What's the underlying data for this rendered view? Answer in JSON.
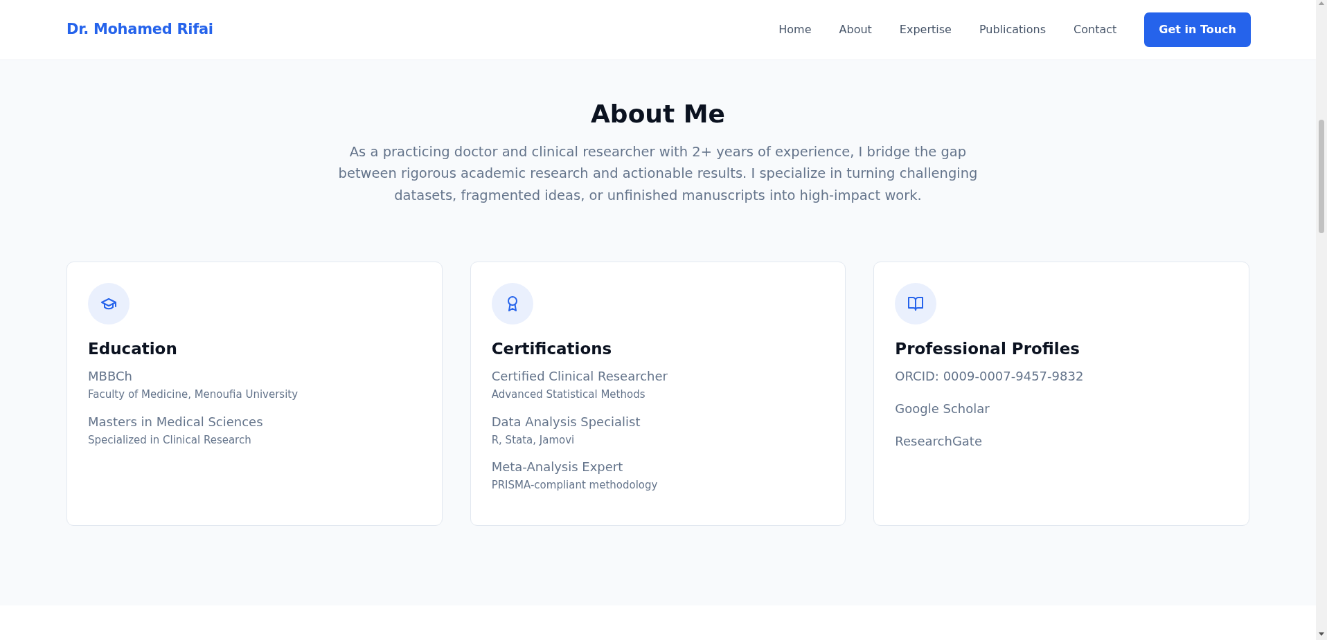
{
  "navbar": {
    "brand": "Dr. Mohamed Rifai",
    "links": [
      "Home",
      "About",
      "Expertise",
      "Publications",
      "Contact"
    ],
    "cta": "Get in Touch"
  },
  "about": {
    "title": "About Me",
    "intro": "As a practicing doctor and clinical researcher with 2+ years of experience, I bridge the gap between rigorous academic research and actionable results. I specialize in turning challenging datasets, fragmented ideas, or unfinished manuscripts into high-impact work.",
    "cards": [
      {
        "title": "Education",
        "items": [
          {
            "title": "MBBCh",
            "subtitle": "Faculty of Medicine, Menoufia University"
          },
          {
            "title": "Masters in Medical Sciences",
            "subtitle": "Specialized in Clinical Research"
          }
        ]
      },
      {
        "title": "Certifications",
        "items": [
          {
            "title": "Certified Clinical Researcher",
            "subtitle": "Advanced Statistical Methods"
          },
          {
            "title": "Data Analysis Specialist",
            "subtitle": "R, Stata, Jamovi"
          },
          {
            "title": "Meta-Analysis Expert",
            "subtitle": "PRISMA-compliant methodology"
          }
        ]
      },
      {
        "title": "Professional Profiles",
        "items": [
          {
            "title": "ORCID: 0009-0007-9457-9832"
          },
          {
            "title": "Google Scholar"
          },
          {
            "title": "ResearchGate"
          }
        ]
      }
    ]
  }
}
